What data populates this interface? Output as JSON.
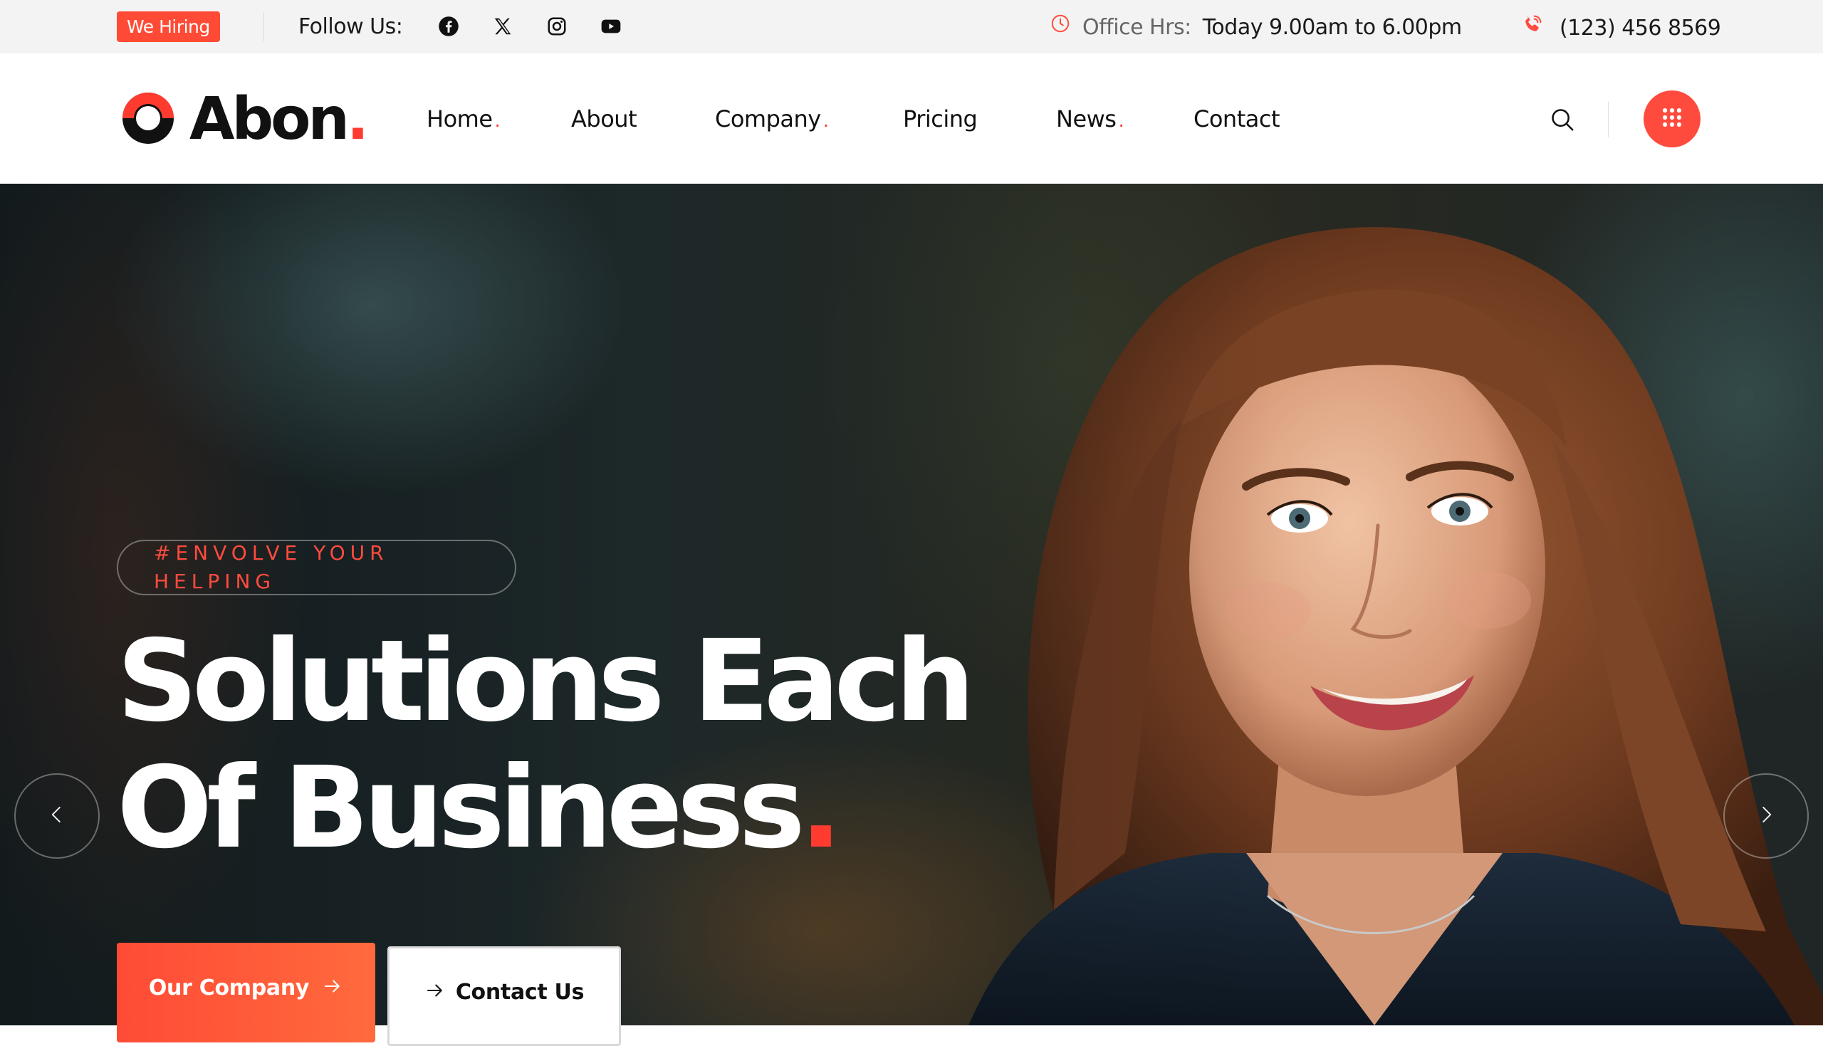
{
  "topbar": {
    "hiring_badge": "We Hiring",
    "follow_label": "Follow Us:",
    "socials": [
      "facebook-icon",
      "x-icon",
      "instagram-icon",
      "youtube-icon"
    ],
    "office_label": "Office Hrs:",
    "office_hours": "Today 9.00am to 6.00pm",
    "phone": "(123) 456 8569"
  },
  "brand": {
    "name": "Abon",
    "dot": ".",
    "accent_color": "#ff4b3e"
  },
  "nav": {
    "items": [
      {
        "label": "Home",
        "has_dropdown": true
      },
      {
        "label": "About",
        "has_dropdown": false
      },
      {
        "label": "Company",
        "has_dropdown": true
      },
      {
        "label": "Pricing",
        "has_dropdown": false
      },
      {
        "label": "News",
        "has_dropdown": true
      },
      {
        "label": "Contact",
        "has_dropdown": false
      }
    ],
    "dot": "."
  },
  "hero": {
    "tagline": "#ENVOLVE YOUR HELPING",
    "headline_line1": "Solutions Each",
    "headline_line2": "Of Business",
    "headline_dot": ".",
    "primary_button": "Our Company",
    "secondary_button": "Contact Us"
  }
}
